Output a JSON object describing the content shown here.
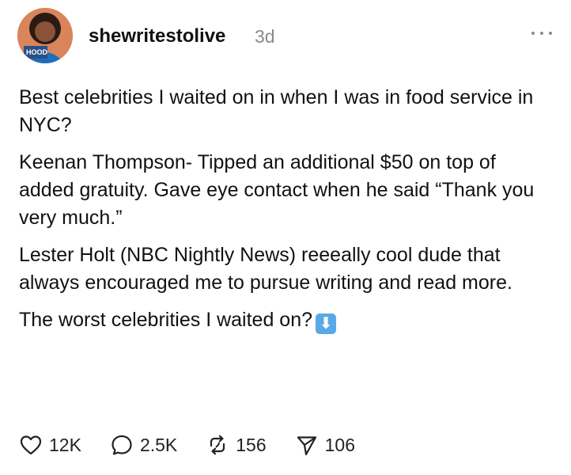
{
  "post": {
    "username": "shewritestolive",
    "time": "3d",
    "avatar_label": "HOOD",
    "paragraphs": [
      "Best celebrities I waited on in when I was in food service in NYC?",
      "Keenan Thompson- Tipped an additional $50 on top of added gratuity. Gave eye contact when he said “Thank you very much.”",
      "Lester Holt (NBC Nightly News) reeeally cool dude that always encouraged me to pursue writing and read more."
    ],
    "last_paragraph": "The worst celebrities I waited on?",
    "emoji": "⬇"
  },
  "actions": {
    "likes": "12K",
    "comments": "2.5K",
    "reposts": "156",
    "shares": "106"
  },
  "icons": {
    "like": "heart-icon",
    "comment": "comment-bubble-icon",
    "repost": "repost-icon",
    "share": "send-icon",
    "more": "more-dots-icon"
  },
  "colors": {
    "text": "#111111",
    "muted": "#8a8a8a",
    "emoji_bg": "#5aa9e6"
  }
}
